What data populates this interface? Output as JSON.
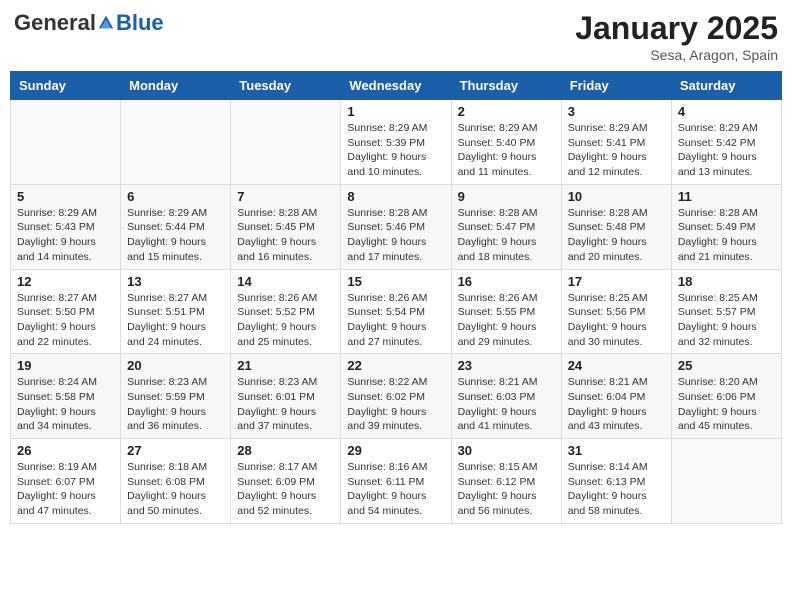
{
  "header": {
    "logo_general": "General",
    "logo_blue": "Blue",
    "month_title": "January 2025",
    "location": "Sesa, Aragon, Spain"
  },
  "days_of_week": [
    "Sunday",
    "Monday",
    "Tuesday",
    "Wednesday",
    "Thursday",
    "Friday",
    "Saturday"
  ],
  "weeks": [
    [
      {
        "day": "",
        "info": ""
      },
      {
        "day": "",
        "info": ""
      },
      {
        "day": "",
        "info": ""
      },
      {
        "day": "1",
        "info": "Sunrise: 8:29 AM\nSunset: 5:39 PM\nDaylight: 9 hours\nand 10 minutes."
      },
      {
        "day": "2",
        "info": "Sunrise: 8:29 AM\nSunset: 5:40 PM\nDaylight: 9 hours\nand 11 minutes."
      },
      {
        "day": "3",
        "info": "Sunrise: 8:29 AM\nSunset: 5:41 PM\nDaylight: 9 hours\nand 12 minutes."
      },
      {
        "day": "4",
        "info": "Sunrise: 8:29 AM\nSunset: 5:42 PM\nDaylight: 9 hours\nand 13 minutes."
      }
    ],
    [
      {
        "day": "5",
        "info": "Sunrise: 8:29 AM\nSunset: 5:43 PM\nDaylight: 9 hours\nand 14 minutes."
      },
      {
        "day": "6",
        "info": "Sunrise: 8:29 AM\nSunset: 5:44 PM\nDaylight: 9 hours\nand 15 minutes."
      },
      {
        "day": "7",
        "info": "Sunrise: 8:28 AM\nSunset: 5:45 PM\nDaylight: 9 hours\nand 16 minutes."
      },
      {
        "day": "8",
        "info": "Sunrise: 8:28 AM\nSunset: 5:46 PM\nDaylight: 9 hours\nand 17 minutes."
      },
      {
        "day": "9",
        "info": "Sunrise: 8:28 AM\nSunset: 5:47 PM\nDaylight: 9 hours\nand 18 minutes."
      },
      {
        "day": "10",
        "info": "Sunrise: 8:28 AM\nSunset: 5:48 PM\nDaylight: 9 hours\nand 20 minutes."
      },
      {
        "day": "11",
        "info": "Sunrise: 8:28 AM\nSunset: 5:49 PM\nDaylight: 9 hours\nand 21 minutes."
      }
    ],
    [
      {
        "day": "12",
        "info": "Sunrise: 8:27 AM\nSunset: 5:50 PM\nDaylight: 9 hours\nand 22 minutes."
      },
      {
        "day": "13",
        "info": "Sunrise: 8:27 AM\nSunset: 5:51 PM\nDaylight: 9 hours\nand 24 minutes."
      },
      {
        "day": "14",
        "info": "Sunrise: 8:26 AM\nSunset: 5:52 PM\nDaylight: 9 hours\nand 25 minutes."
      },
      {
        "day": "15",
        "info": "Sunrise: 8:26 AM\nSunset: 5:54 PM\nDaylight: 9 hours\nand 27 minutes."
      },
      {
        "day": "16",
        "info": "Sunrise: 8:26 AM\nSunset: 5:55 PM\nDaylight: 9 hours\nand 29 minutes."
      },
      {
        "day": "17",
        "info": "Sunrise: 8:25 AM\nSunset: 5:56 PM\nDaylight: 9 hours\nand 30 minutes."
      },
      {
        "day": "18",
        "info": "Sunrise: 8:25 AM\nSunset: 5:57 PM\nDaylight: 9 hours\nand 32 minutes."
      }
    ],
    [
      {
        "day": "19",
        "info": "Sunrise: 8:24 AM\nSunset: 5:58 PM\nDaylight: 9 hours\nand 34 minutes."
      },
      {
        "day": "20",
        "info": "Sunrise: 8:23 AM\nSunset: 5:59 PM\nDaylight: 9 hours\nand 36 minutes."
      },
      {
        "day": "21",
        "info": "Sunrise: 8:23 AM\nSunset: 6:01 PM\nDaylight: 9 hours\nand 37 minutes."
      },
      {
        "day": "22",
        "info": "Sunrise: 8:22 AM\nSunset: 6:02 PM\nDaylight: 9 hours\nand 39 minutes."
      },
      {
        "day": "23",
        "info": "Sunrise: 8:21 AM\nSunset: 6:03 PM\nDaylight: 9 hours\nand 41 minutes."
      },
      {
        "day": "24",
        "info": "Sunrise: 8:21 AM\nSunset: 6:04 PM\nDaylight: 9 hours\nand 43 minutes."
      },
      {
        "day": "25",
        "info": "Sunrise: 8:20 AM\nSunset: 6:06 PM\nDaylight: 9 hours\nand 45 minutes."
      }
    ],
    [
      {
        "day": "26",
        "info": "Sunrise: 8:19 AM\nSunset: 6:07 PM\nDaylight: 9 hours\nand 47 minutes."
      },
      {
        "day": "27",
        "info": "Sunrise: 8:18 AM\nSunset: 6:08 PM\nDaylight: 9 hours\nand 50 minutes."
      },
      {
        "day": "28",
        "info": "Sunrise: 8:17 AM\nSunset: 6:09 PM\nDaylight: 9 hours\nand 52 minutes."
      },
      {
        "day": "29",
        "info": "Sunrise: 8:16 AM\nSunset: 6:11 PM\nDaylight: 9 hours\nand 54 minutes."
      },
      {
        "day": "30",
        "info": "Sunrise: 8:15 AM\nSunset: 6:12 PM\nDaylight: 9 hours\nand 56 minutes."
      },
      {
        "day": "31",
        "info": "Sunrise: 8:14 AM\nSunset: 6:13 PM\nDaylight: 9 hours\nand 58 minutes."
      },
      {
        "day": "",
        "info": ""
      }
    ]
  ]
}
